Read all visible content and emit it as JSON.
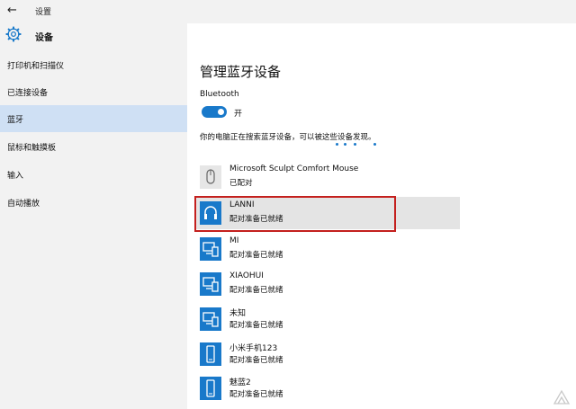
{
  "window": {
    "back_icon": "back-arrow-icon",
    "title": "设置"
  },
  "sidebar": {
    "header": {
      "icon": "gear-icon",
      "title": "设备"
    },
    "items": [
      {
        "label": "打印机和扫描仪",
        "active": false
      },
      {
        "label": "已连接设备",
        "active": false
      },
      {
        "label": "蓝牙",
        "active": true
      },
      {
        "label": "鼠标和触摸板",
        "active": false
      },
      {
        "label": "输入",
        "active": false
      },
      {
        "label": "自动播放",
        "active": false
      }
    ]
  },
  "main": {
    "heading": "管理蓝牙设备",
    "bluetooth_label": "Bluetooth",
    "toggle": {
      "state": "on",
      "label": "开"
    },
    "searching_text": "你的电脑正在搜索蓝牙设备，可以被这些设备发现。",
    "devices": [
      {
        "name": "Microsoft Sculpt Comfort Mouse",
        "status": "已配对",
        "icon": "mouse-icon",
        "selected": false
      },
      {
        "name": "LANNI",
        "status": "配对准备已就绪",
        "icon": "headset-icon",
        "selected": true
      },
      {
        "name": "MI",
        "status": "配对准备已就绪",
        "icon": "computer-phone-icon",
        "selected": false
      },
      {
        "name": "XIAOHUI",
        "status": "配对准备已就绪",
        "icon": "computer-phone-icon",
        "selected": false
      },
      {
        "name": "未知",
        "status": "配对准备已就绪",
        "icon": "computer-phone-icon",
        "selected": false
      },
      {
        "name": "小米手机123",
        "status": "配对准备已就绪",
        "icon": "phone-icon",
        "selected": false
      },
      {
        "name": "魅蓝2",
        "status": "配对准备已就绪",
        "icon": "phone-icon",
        "selected": false
      }
    ]
  },
  "colors": {
    "accent": "#1979ca",
    "highlight": "#c4201e",
    "sidebar_bg": "#f2f2f2",
    "sidebar_active": "#cfe0f4"
  }
}
